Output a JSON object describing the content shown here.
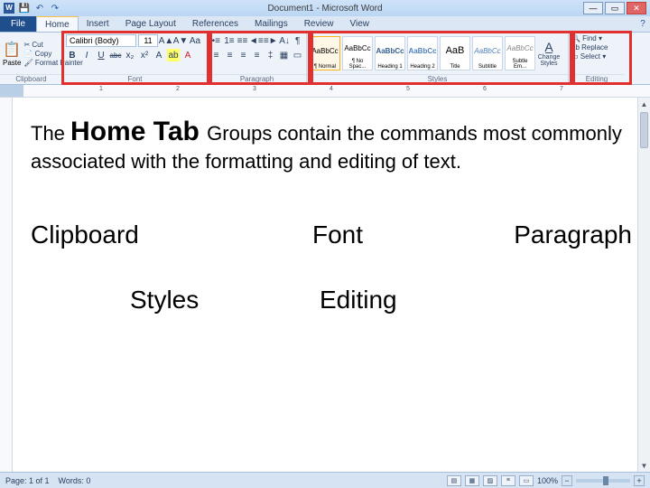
{
  "titlebar": {
    "title": "Document1 - Microsoft Word",
    "qat": {
      "save": "💾",
      "undo": "↶",
      "redo": "↷"
    },
    "min": "—",
    "max": "▭",
    "close": "✕"
  },
  "tabs": {
    "file": "File",
    "items": [
      "Home",
      "Insert",
      "Page Layout",
      "References",
      "Mailings",
      "Review",
      "View"
    ],
    "active": 0,
    "help": "?"
  },
  "ribbon": {
    "clipboard": {
      "label": "Clipboard",
      "paste": "Paste",
      "cut": "✂ Cut",
      "copy": "📄 Copy",
      "format_painter": "🖌 Format Painter"
    },
    "font": {
      "label": "Font",
      "family": "Calibri (Body)",
      "size": "11",
      "grow": "A▲",
      "shrink": "A▼",
      "clear": "Aa",
      "bold": "B",
      "italic": "I",
      "underline": "U",
      "strike": "abc",
      "sub": "x₂",
      "sup": "x²",
      "effects": "A",
      "highlight": "ab",
      "color": "A"
    },
    "paragraph": {
      "label": "Paragraph",
      "bullets": "•≡",
      "numbers": "1≡",
      "multilevel": "≡≡",
      "dec_indent": "◄≡",
      "inc_indent": "≡►",
      "sort": "A↓",
      "marks": "¶",
      "al": "≡",
      "ac": "≡",
      "ar": "≡",
      "aj": "≡",
      "spacing": "‡",
      "shading": "▦",
      "borders": "▭"
    },
    "styles": {
      "label": "Styles",
      "tiles": [
        {
          "preview": "AaBbCc",
          "name": "¶ Normal"
        },
        {
          "preview": "AaBbCc",
          "name": "¶ No Spac..."
        },
        {
          "preview": "AaBbCc",
          "name": "Heading 1"
        },
        {
          "preview": "AaBbCc",
          "name": "Heading 2"
        },
        {
          "preview": "AaB",
          "name": "Title"
        },
        {
          "preview": "AaBbCc",
          "name": "Subtitle"
        },
        {
          "preview": "AaBbCc",
          "name": "Subtle Em..."
        }
      ],
      "change": "Change Styles"
    },
    "editing": {
      "label": "Editing",
      "find": "🔍 Find ▾",
      "replace": "ab Replace",
      "select": "▭ Select ▾"
    }
  },
  "ruler": {
    "marks": [
      "1",
      "2",
      "3",
      "4",
      "5",
      "6",
      "7"
    ]
  },
  "document": {
    "text_the": "The ",
    "text_hometab": "Home Tab ",
    "text_rest1": "Groups contain the commands most commonly associated with the formatting and editing of text.",
    "row1": [
      "Clipboard",
      "Font",
      "Paragraph"
    ],
    "row2": [
      "Styles",
      "Editing"
    ]
  },
  "status": {
    "page": "Page: 1 of 1",
    "words": "Words: 0",
    "zoom_pct": "100%",
    "minus": "−",
    "plus": "+"
  }
}
